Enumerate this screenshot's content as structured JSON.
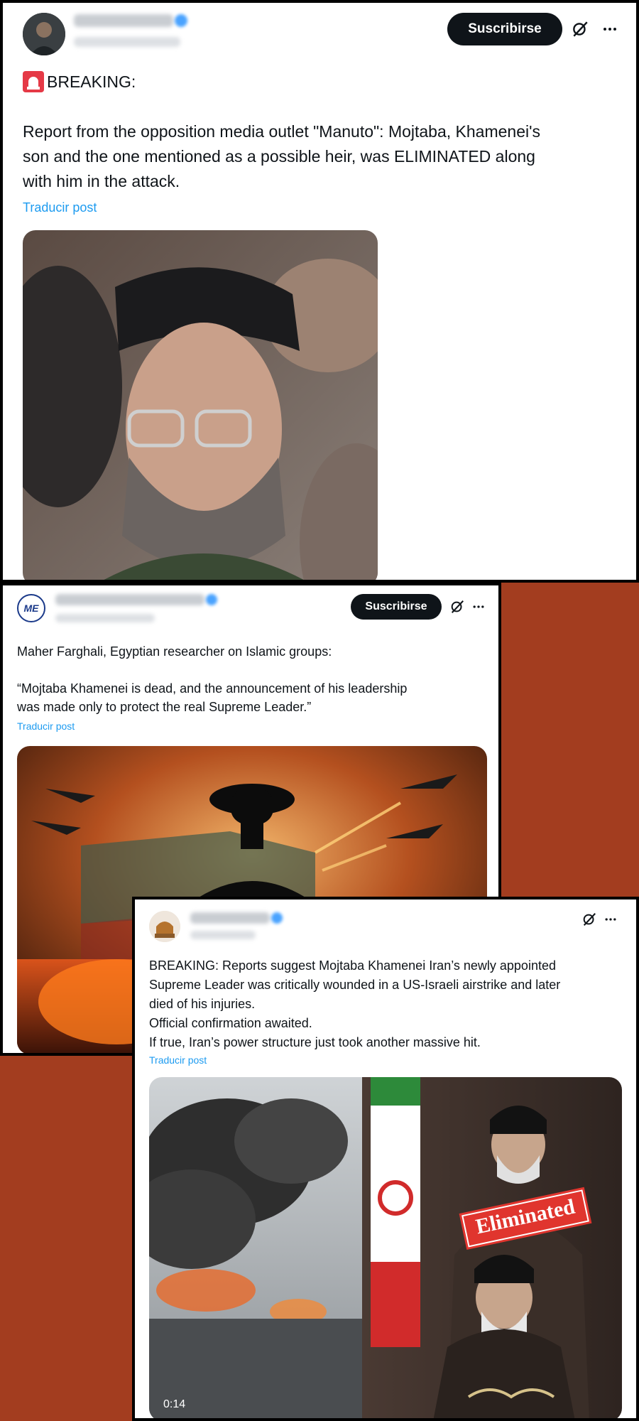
{
  "posts": [
    {
      "subscribe_label": "Suscribirse",
      "breaking": "BREAKING:",
      "text": "Report from the opposition media outlet \"Manuto\": Mojtaba, Khamenei's\nson and the one mentioned as a possible heir, was ELIMINATED along\nwith him in the attack.",
      "translate_label": "Traducir post"
    },
    {
      "avatar_label": "ME",
      "subscribe_label": "Suscribirse",
      "text": "Maher Farghali, Egyptian researcher on Islamic groups:\n\n“Mojtaba Khamenei is dead, and the announcement of his leadership\nwas made only to protect the real Supreme Leader.”",
      "translate_label": "Traducir post"
    },
    {
      "text": "BREAKING: Reports suggest Mojtaba Khamenei Iran’s newly appointed\nSupreme Leader was critically wounded in a US-Israeli airstrike and later\ndied of his injuries.\nOfficial confirmation awaited.\nIf true, Iran’s power structure just took another massive hit.",
      "translate_label": "Traducir post",
      "video_overlay_label": "Eliminated",
      "video_duration": "0:14"
    }
  ],
  "colors": {
    "background": "#a33d1f",
    "link": "#1d9bf0",
    "button": "#0f1419"
  },
  "icons": [
    "siren-icon",
    "grok-icon",
    "more-icon",
    "verified-badge-icon"
  ]
}
